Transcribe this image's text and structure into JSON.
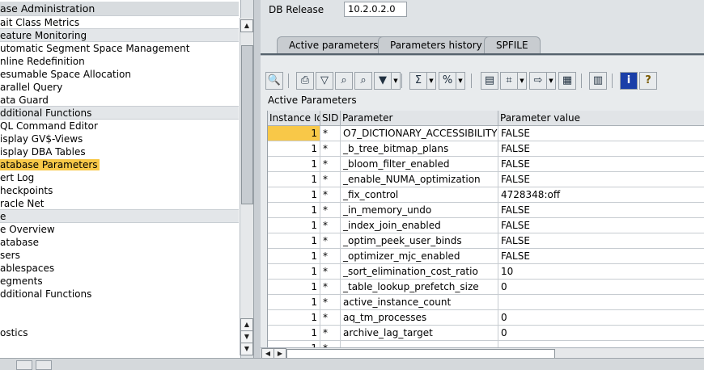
{
  "tree": {
    "rows": [
      {
        "label": "ase Administration",
        "kind": "head"
      },
      {
        "label": "ait Class Metrics",
        "kind": "item"
      },
      {
        "label": "eature Monitoring",
        "kind": "section"
      },
      {
        "label": "utomatic Segment Space Management",
        "kind": "item"
      },
      {
        "label": "nline Redefinition",
        "kind": "item"
      },
      {
        "label": "esumable Space Allocation",
        "kind": "item"
      },
      {
        "label": "arallel Query",
        "kind": "item"
      },
      {
        "label": "ata Guard",
        "kind": "item"
      },
      {
        "label": "dditional Functions",
        "kind": "section"
      },
      {
        "label": "QL Command Editor",
        "kind": "item"
      },
      {
        "label": "isplay GV$-Views",
        "kind": "item"
      },
      {
        "label": "isplay DBA Tables",
        "kind": "item"
      },
      {
        "label": "atabase Parameters",
        "kind": "selected"
      },
      {
        "label": "ert Log",
        "kind": "item"
      },
      {
        "label": "heckpoints",
        "kind": "item"
      },
      {
        "label": "racle Net",
        "kind": "item"
      },
      {
        "label": "e",
        "kind": "section"
      },
      {
        "label": "e Overview",
        "kind": "item"
      },
      {
        "label": "atabase",
        "kind": "item"
      },
      {
        "label": "sers",
        "kind": "item"
      },
      {
        "label": "ablespaces",
        "kind": "item"
      },
      {
        "label": "egments",
        "kind": "item"
      },
      {
        "label": "dditional Functions",
        "kind": "item"
      },
      {
        "label": "",
        "kind": "item"
      },
      {
        "label": "",
        "kind": "item"
      },
      {
        "label": "ostics",
        "kind": "item"
      }
    ]
  },
  "scroll_icons": {
    "up": "▲",
    "down": "▼"
  },
  "db_release": {
    "label": "DB Release",
    "value": "10.2.0.2.0"
  },
  "tabs": [
    {
      "label": "Active parameters",
      "active": true
    },
    {
      "label": "Parameters history",
      "active": false
    },
    {
      "label": "SPFILE",
      "active": false
    }
  ],
  "toolbar": {
    "icons": [
      "details-icon",
      "print-icon",
      "filter-icon",
      "find-icon",
      "find-next-icon",
      "set-filter-icon",
      "sum-icon",
      "subtotal-icon",
      "print-preview-icon",
      "export-icon",
      "send-icon",
      "spreadsheet-icon",
      "change-layout-icon",
      "information-icon",
      "help-icon"
    ],
    "glyphs": [
      "🔍",
      "⎙",
      "▽",
      "⌕",
      "⌕",
      "▼",
      "Σ",
      "%",
      "▤",
      "⌗",
      "⇨",
      "▦",
      "▥",
      "i",
      "?"
    ]
  },
  "grid": {
    "title": "Active Parameters",
    "columns": [
      "Instance Id",
      "SID",
      "Parameter",
      "Parameter value"
    ],
    "rows": [
      [
        "1",
        "*",
        "O7_DICTIONARY_ACCESSIBILITY",
        "FALSE"
      ],
      [
        "1",
        "*",
        "_b_tree_bitmap_plans",
        "FALSE"
      ],
      [
        "1",
        "*",
        "_bloom_filter_enabled",
        "FALSE"
      ],
      [
        "1",
        "*",
        "_enable_NUMA_optimization",
        "FALSE"
      ],
      [
        "1",
        "*",
        "_fix_control",
        "4728348:off"
      ],
      [
        "1",
        "*",
        "_in_memory_undo",
        "FALSE"
      ],
      [
        "1",
        "*",
        "_index_join_enabled",
        "FALSE"
      ],
      [
        "1",
        "*",
        "_optim_peek_user_binds",
        "FALSE"
      ],
      [
        "1",
        "*",
        "_optimizer_mjc_enabled",
        "FALSE"
      ],
      [
        "1",
        "*",
        "_sort_elimination_cost_ratio",
        "10"
      ],
      [
        "1",
        "*",
        "_table_lookup_prefetch_size",
        "0"
      ],
      [
        "1",
        "*",
        "active_instance_count",
        ""
      ],
      [
        "1",
        "*",
        "aq_tm_processes",
        "0"
      ],
      [
        "1",
        "*",
        "archive_lag_target",
        "0"
      ],
      [
        "1",
        "*",
        "",
        ""
      ]
    ]
  },
  "hscroll_icons": {
    "left": "◀",
    "right": "▶"
  },
  "colors": {
    "selection": "#f8c848",
    "active_tab": "#55626c"
  }
}
